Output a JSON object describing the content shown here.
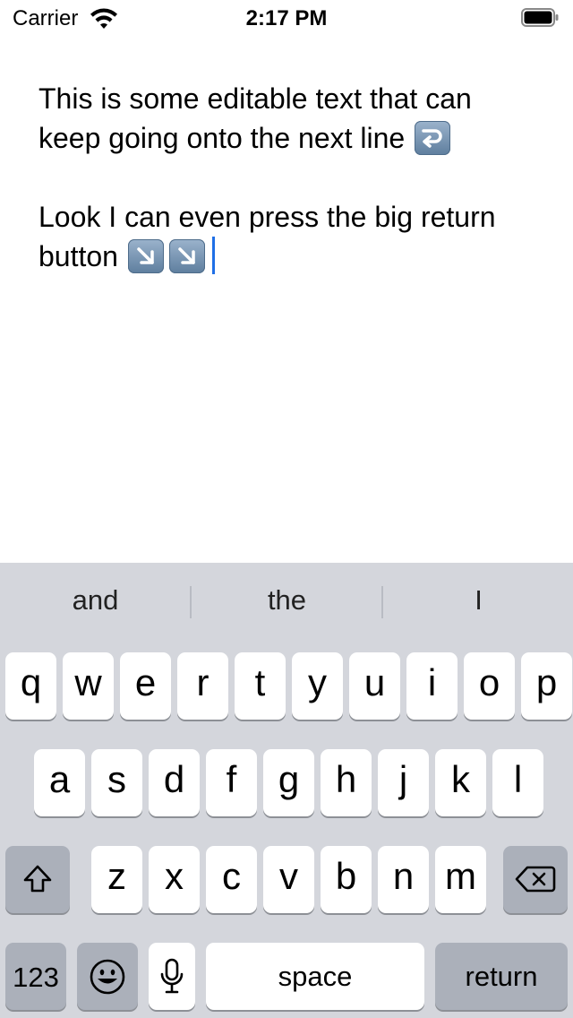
{
  "status_bar": {
    "carrier": "Carrier",
    "time": "2:17 PM",
    "icons": [
      "wifi-icon",
      "battery-icon"
    ]
  },
  "editor": {
    "paragraph1": "This is some editable text that can keep going onto the next line",
    "paragraph1_emoji": "right-arrow-curving-left-emoji",
    "paragraph2": "Look I can even press the big return button",
    "paragraph2_emojis": [
      "down-right-arrow-emoji",
      "down-right-arrow-emoji"
    ],
    "caret_color": "#1f6fe6"
  },
  "keyboard": {
    "suggestions": [
      "and",
      "the",
      "I"
    ],
    "row1": [
      "q",
      "w",
      "e",
      "r",
      "t",
      "y",
      "u",
      "i",
      "o",
      "p"
    ],
    "row2": [
      "a",
      "s",
      "d",
      "f",
      "g",
      "h",
      "j",
      "k",
      "l"
    ],
    "row3": [
      "z",
      "x",
      "c",
      "v",
      "b",
      "n",
      "m"
    ],
    "numbers_label": "123",
    "space_label": "space",
    "return_label": "return",
    "icons": [
      "shift-icon",
      "delete-icon",
      "emoji-icon",
      "microphone-icon"
    ],
    "colors": {
      "background": "#d4d6dc",
      "key": "#ffffff",
      "dark_key": "#abb0ba"
    }
  }
}
